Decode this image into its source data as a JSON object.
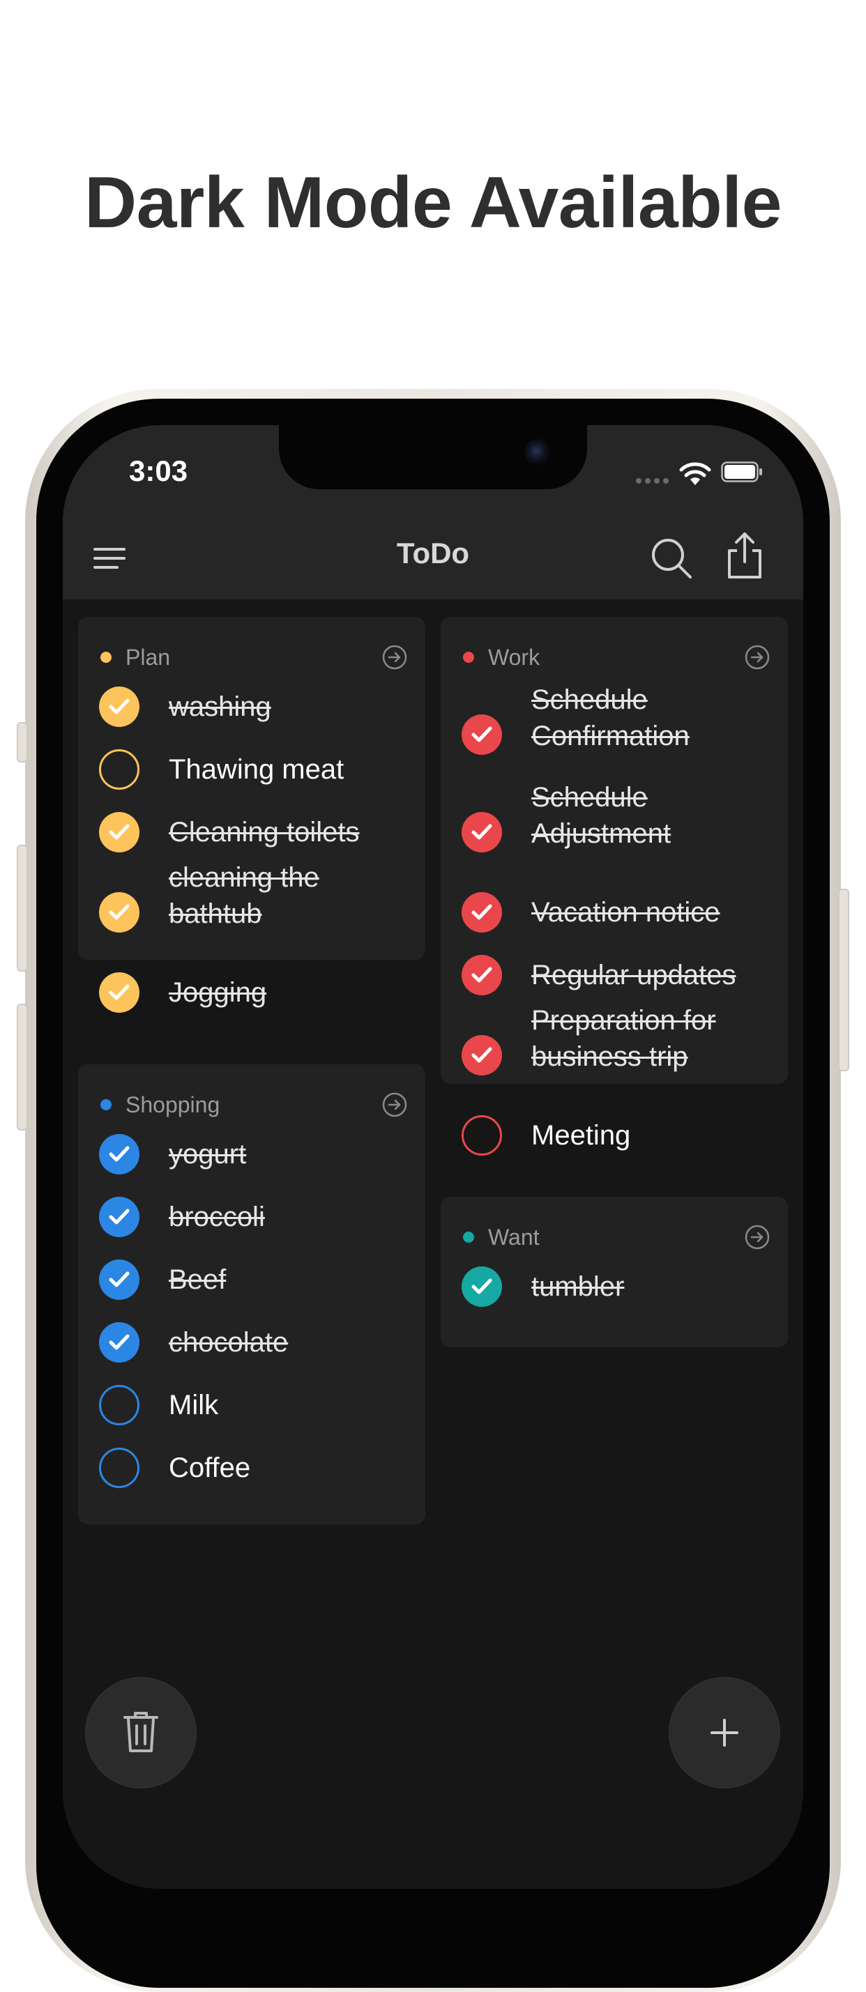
{
  "headline": "Dark Mode Available",
  "status_bar": {
    "time": "3:03"
  },
  "nav": {
    "title": "ToDo",
    "icons": [
      "menu-icon",
      "search-icon",
      "share-icon"
    ]
  },
  "colors": {
    "plan": "#fcc45a",
    "work": "#e9474c",
    "shopping": "#2c86e4",
    "want": "#16a8a2",
    "background": "#161616",
    "card": "#222222"
  },
  "lists": {
    "plan": {
      "title": "Plan",
      "items": [
        {
          "text": "washing",
          "done": true
        },
        {
          "text": "Thawing meat",
          "done": false
        },
        {
          "text": "Cleaning toilets",
          "done": true
        },
        {
          "text": "cleaning the bathtub",
          "done": true
        },
        {
          "text": "Jogging",
          "done": true
        }
      ]
    },
    "work": {
      "title": "Work",
      "items": [
        {
          "text": "Schedule Confirmation",
          "done": true
        },
        {
          "text": "Schedule Adjustment",
          "done": true
        },
        {
          "text": "Vacation notice",
          "done": true
        },
        {
          "text": "Regular updates",
          "done": true
        },
        {
          "text": "Preparation for business trip",
          "done": true
        },
        {
          "text": "Meeting",
          "done": false
        }
      ]
    },
    "shopping": {
      "title": "Shopping",
      "items": [
        {
          "text": "yogurt",
          "done": true
        },
        {
          "text": "broccoli",
          "done": true
        },
        {
          "text": "Beef",
          "done": true
        },
        {
          "text": "chocolate",
          "done": true
        },
        {
          "text": "Milk",
          "done": false
        },
        {
          "text": "Coffee",
          "done": false
        }
      ]
    },
    "want": {
      "title": "Want",
      "items": [
        {
          "text": "tumbler",
          "done": true
        }
      ]
    }
  },
  "actions": {
    "delete_icon": "trash-icon",
    "add_icon": "plus-icon"
  }
}
